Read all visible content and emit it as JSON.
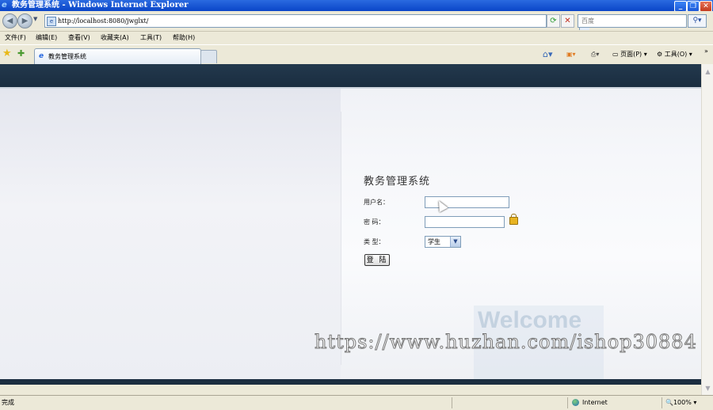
{
  "window": {
    "title": "教务管理系统 - Windows Internet Explorer",
    "minimize_glyph": "_",
    "maximize_glyph": "❐",
    "close_glyph": "✕"
  },
  "address_bar": {
    "url": "http://localhost:8080/jwglxt/",
    "search_placeholder": "百度"
  },
  "menu": {
    "items": [
      "文件(F)",
      "编辑(E)",
      "查看(V)",
      "收藏夹(A)",
      "工具(T)",
      "帮助(H)"
    ]
  },
  "tabs": {
    "active_label": "教务管理系统"
  },
  "command_bar": {
    "page_label": "页面(P)",
    "tools_label": "工具(O)",
    "overflow": "»"
  },
  "login": {
    "title": "教务管理系统",
    "username_label": "用户名：",
    "password_label": "密  码：",
    "type_label": "类  型：",
    "type_selected": "学生",
    "submit_label": "登 陆"
  },
  "page": {
    "welcome_text": "Welcome",
    "watermark": "https://www.huzhan.com/ishop30884"
  },
  "status_bar": {
    "status": "完成",
    "zone": "Internet",
    "zoom": "100%"
  },
  "colors": {
    "banner": "#1f3447",
    "titlebar": "#0a45c8"
  }
}
